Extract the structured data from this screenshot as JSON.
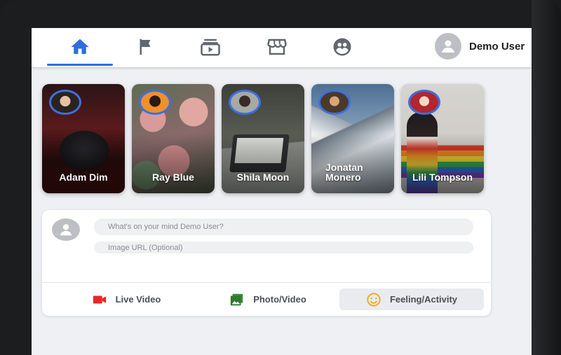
{
  "header": {
    "nav": [
      {
        "name": "home",
        "icon": "home-icon",
        "active": true
      },
      {
        "name": "pages",
        "icon": "flag-icon",
        "active": false
      },
      {
        "name": "watch",
        "icon": "video-icon",
        "active": false
      },
      {
        "name": "marketplace",
        "icon": "storefront-icon",
        "active": false
      },
      {
        "name": "groups",
        "icon": "groups-icon",
        "active": false
      }
    ],
    "user_name": "Demo User",
    "accent": "#2d6ee0"
  },
  "stories": [
    {
      "name": "Adam Dim"
    },
    {
      "name": "Ray Blue"
    },
    {
      "name": "Shila Moon"
    },
    {
      "name": "Jonatan Monero"
    },
    {
      "name": "Lili Tompson"
    }
  ],
  "composer": {
    "text_placeholder": "What's on your mind Demo User?",
    "url_placeholder": "Image URL (Optional)",
    "actions": [
      {
        "label": "Live Video",
        "icon": "video-camera-icon",
        "color": "#e42a2a"
      },
      {
        "label": "Photo/Video",
        "icon": "photo-icon",
        "color": "#3b8b3b"
      },
      {
        "label": "Feeling/Activity",
        "icon": "smiley-icon",
        "color": "#f2a619"
      }
    ]
  }
}
